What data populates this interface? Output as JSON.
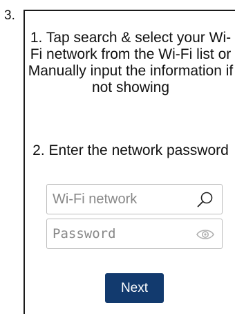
{
  "step": {
    "number": "3."
  },
  "instructions": {
    "line1": "1. Tap search & select your Wi-Fi network from the Wi-Fi list or Manually input the information if not showing",
    "line2": "2. Enter the network password"
  },
  "wifi_field": {
    "placeholder": "Wi-Fi network",
    "value": "",
    "icon": "search-icon"
  },
  "password_field": {
    "placeholder": "Password",
    "value": "",
    "icon": "eye-icon"
  },
  "next_button": {
    "label": "Next"
  },
  "colors": {
    "accent": "#123a6e",
    "field_border": "#bdbdbd",
    "icon_gray": "#b0b0b0"
  }
}
